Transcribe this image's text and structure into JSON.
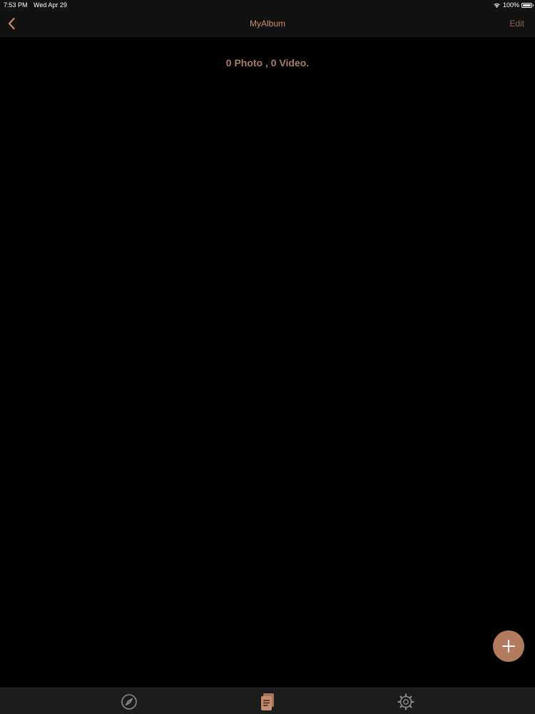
{
  "status_bar": {
    "time": "7:53 PM",
    "date": "Wed Apr 29",
    "battery": "100%",
    "icons": [
      "wifi-icon",
      "battery-icon"
    ]
  },
  "nav": {
    "title": "MyAlbum",
    "edit_label": "Edit",
    "back_icon": "chevron-left-icon"
  },
  "content": {
    "summary": "0 Photo , 0 Video."
  },
  "fab": {
    "icon": "plus-icon"
  },
  "tab_bar": {
    "items": [
      {
        "icon": "compass-icon",
        "selected": false
      },
      {
        "icon": "document-icon",
        "selected": true
      },
      {
        "icon": "gear-icon",
        "selected": false
      }
    ]
  },
  "colors": {
    "accent": "#c58d6e",
    "fab": "#b27b5e",
    "background": "#000000",
    "bar": "#121212",
    "tab_inactive": "#8a8a8a"
  }
}
